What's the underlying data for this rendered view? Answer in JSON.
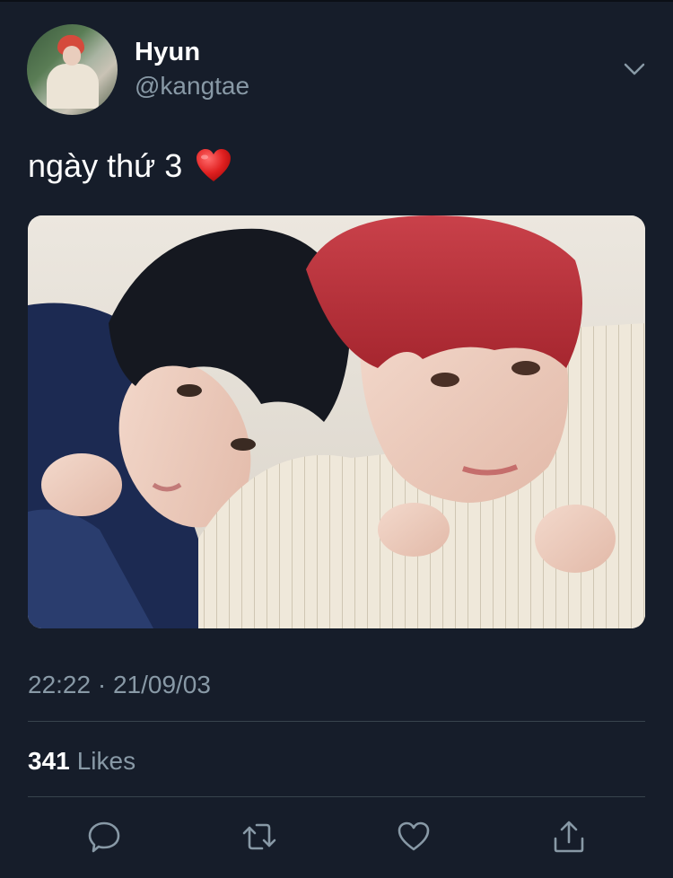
{
  "author": {
    "display_name": "Hyun",
    "handle": "@kangtae"
  },
  "tweet": {
    "text": "ngày thứ 3",
    "emoji": "red-heart-emoji"
  },
  "meta": {
    "timestamp": "22:22 · 21/09/03",
    "likes_count": "341",
    "likes_label": "Likes"
  },
  "actions": [
    {
      "name": "reply",
      "icon": "speech-bubble-icon"
    },
    {
      "name": "retweet",
      "icon": "retweet-arrows-icon"
    },
    {
      "name": "like",
      "icon": "heart-outline-icon"
    },
    {
      "name": "share",
      "icon": "share-upload-icon"
    }
  ],
  "colors": {
    "background": "#161d2a",
    "secondary_text": "#8899a6",
    "divider": "#38444d",
    "heart_red": "#e0245e"
  }
}
